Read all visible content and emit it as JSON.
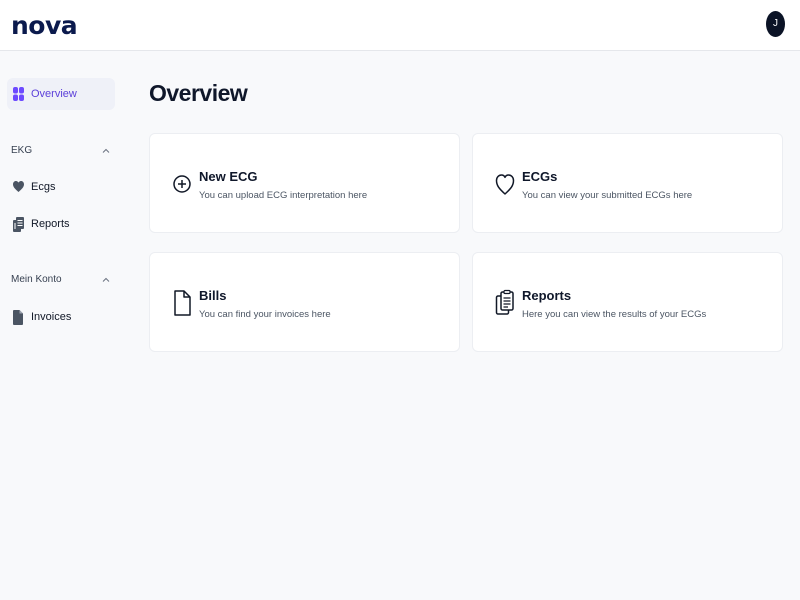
{
  "header": {
    "logo": "nova",
    "avatar_initial": "J"
  },
  "sidebar": {
    "overview_label": "Overview",
    "sections": [
      {
        "label": "EKG",
        "items": [
          {
            "label": "Ecgs",
            "icon": "heart-icon"
          },
          {
            "label": "Reports",
            "icon": "clipboard-icon"
          }
        ]
      },
      {
        "label": "Mein Konto",
        "items": [
          {
            "label": "Invoices",
            "icon": "document-icon"
          }
        ]
      }
    ]
  },
  "main": {
    "title": "Overview",
    "cards": [
      {
        "title": "New ECG",
        "description": "You can upload ECG interpretation here",
        "icon": "plus-circle-icon"
      },
      {
        "title": "ECGs",
        "description": "You can view your submitted ECGs here",
        "icon": "heart-outline-icon"
      },
      {
        "title": "Bills",
        "description": "You can find your invoices here",
        "icon": "file-icon"
      },
      {
        "title": "Reports",
        "description": "Here you can view the results of your ECGs",
        "icon": "clipboard-outline-icon"
      }
    ]
  },
  "colors": {
    "accent": "#5b3fd9",
    "logo": "#0b1a4d",
    "background": "#f8f9fb"
  }
}
